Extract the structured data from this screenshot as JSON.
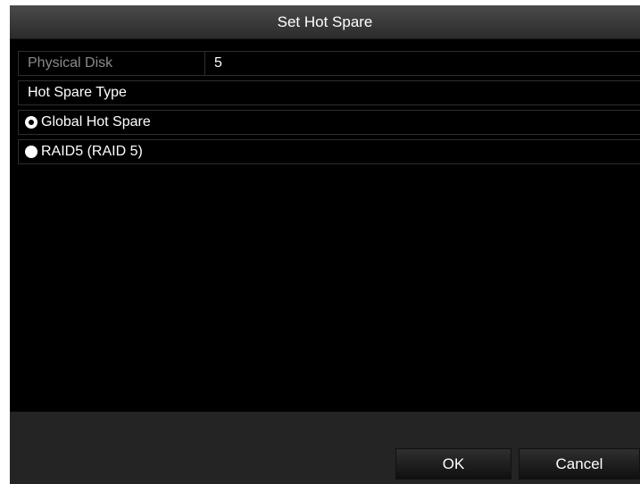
{
  "dialog": {
    "title": "Set Hot Spare"
  },
  "form": {
    "physical_disk_label": "Physical Disk",
    "physical_disk_value": "5",
    "hot_spare_type_label": "Hot Spare Type",
    "options": [
      {
        "label": "Global Hot Spare",
        "selected": true
      },
      {
        "label": "RAID5 (RAID 5)",
        "selected": false
      }
    ]
  },
  "buttons": {
    "ok_label": "OK",
    "cancel_label": "Cancel"
  },
  "colors": {
    "background": "#000000",
    "title_bar": "#3a3a3a",
    "footer": "#242424",
    "disabled_text": "#8a8a8a",
    "text": "#ffffff"
  }
}
